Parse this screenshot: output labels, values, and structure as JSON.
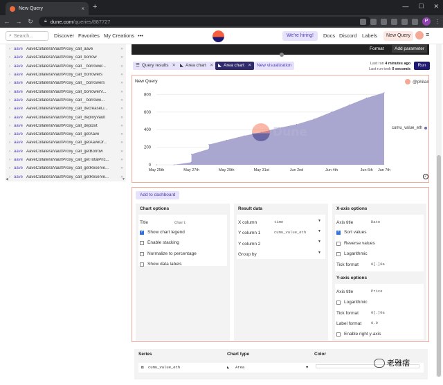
{
  "browser": {
    "tab_title": "New Query",
    "tab_close": "×",
    "new_tab": "+",
    "url_host": "dune.com",
    "url_path": "/queries/887727",
    "profile_initial": "P"
  },
  "header": {
    "search_placeholder": "Search...",
    "nav": [
      "Discover",
      "Favorites",
      "My Creations"
    ],
    "more": "•••",
    "hiring": "We're hiring!",
    "right_nav": [
      "Docs",
      "Discord",
      "Labels"
    ],
    "new_query": "New Query"
  },
  "sidebar": {
    "namespace": "aave",
    "items": [
      "AaveCollateralVaultProxy_call_aave",
      "AaveCollateralVaultProxy_call_borrow",
      "AaveCollateralVaultProxy_call__borrower...",
      "AaveCollateralVaultProxy_call_borrowers",
      "AaveCollateralVaultProxy_call__borrowers",
      "AaveCollateralVaultProxy_call_borrowerV...",
      "AaveCollateralVaultProxy_call__borrowe...",
      "AaveCollateralVaultProxy_call_decreaseLi...",
      "AaveCollateralVaultProxy_call_deployVault",
      "AaveCollateralVaultProxy_call_deposit",
      "AaveCollateralVaultProxy_call_getAave",
      "AaveCollateralVaultProxy_call_getAaveOr...",
      "AaveCollateralVaultProxy_call_getBorrow",
      "AaveCollateralVaultProxy_call_getTotalPric...",
      "AaveCollateralVaultProxy_call_getReserve...",
      "AaveCollateralVaultProxy_call_getReserve..."
    ]
  },
  "editor": {
    "format": "Format",
    "add_parameter": "Add parameter"
  },
  "viz_tabs": [
    {
      "label": "Query results",
      "icon": "☰"
    },
    {
      "label": "Area chart",
      "icon": "◣"
    },
    {
      "label": "Area chart",
      "icon": "◣",
      "active": true
    }
  ],
  "new_visualization": "New visualization",
  "run_info": {
    "last_run_prefix": "Last run",
    "last_run_value": "4 minutes ago",
    "last_took_prefix": "Last run took",
    "last_took_value": "0 seconds",
    "run_button": "Run"
  },
  "chart_panel": {
    "title": "New Query",
    "owner": "@philan",
    "watermark": "Dune"
  },
  "chart_data": {
    "type": "area",
    "title": "",
    "series": [
      {
        "name": "cumu_value_eth",
        "x": [
          "2022-05-25",
          "2022-05-26",
          "2022-05-27",
          "2022-05-27",
          "2022-05-28",
          "2022-05-28",
          "2022-05-29",
          "2022-05-30",
          "2022-05-31",
          "2022-06-01",
          "2022-06-02",
          "2022-06-03",
          "2022-06-04",
          "2022-06-05",
          "2022-06-06",
          "2022-06-07"
        ],
        "values": [
          0,
          0,
          30,
          120,
          180,
          230,
          280,
          330,
          370,
          420,
          460,
          520,
          600,
          680,
          760,
          820
        ]
      }
    ],
    "xticks": [
      "May 25th",
      "May 27th",
      "May 29th",
      "May 31st",
      "Jun 2nd",
      "Jun 4th",
      "Jun 6th",
      "Jun 7th"
    ],
    "yticks": [
      "0",
      "200",
      "400",
      "600",
      "800"
    ],
    "ylim": [
      0,
      850
    ],
    "legend": "right",
    "color": "#a9a7d0"
  },
  "add_to_dashboard": "Add to dashboard",
  "chart_options": {
    "heading": "Chart options",
    "title_label": "Title",
    "title_value": "Chart",
    "checks": [
      {
        "label": "Show chart legend",
        "on": true
      },
      {
        "label": "Enable stacking",
        "on": false
      },
      {
        "label": "Normalize to percentage",
        "on": false
      },
      {
        "label": "Show data labels",
        "on": false
      }
    ]
  },
  "result_data": {
    "heading": "Result data",
    "x_label": "X column",
    "x_value": "time",
    "y1_label": "Y column 1",
    "y1_value": "cumu_value_eth",
    "y2_label": "Y column 2",
    "group_label": "Group by"
  },
  "x_axis": {
    "heading": "X-axis options",
    "title_label": "Axis title",
    "title_value": "Date",
    "checks": [
      {
        "label": "Sort values",
        "on": true
      },
      {
        "label": "Reverse values",
        "on": false
      },
      {
        "label": "Logarithmic",
        "on": false
      }
    ],
    "tick_label": "Tick format",
    "tick_value": "0[.]0a"
  },
  "y_axis": {
    "heading": "Y-axis options",
    "title_label": "Axis title",
    "title_value": "Price",
    "log_label": "Logarithmic",
    "tick_label": "Tick format",
    "tick_value": "0[.]0a",
    "label_label": "Label format",
    "label_value": "0.0",
    "right_label": "Enable right y-axis"
  },
  "series_panel": {
    "col_series": "Series",
    "col_type": "Chart type",
    "col_color": "Color",
    "series_value": "cumu_value_eth",
    "type_value": "Area"
  },
  "watermark_wechat": "老雅痞"
}
